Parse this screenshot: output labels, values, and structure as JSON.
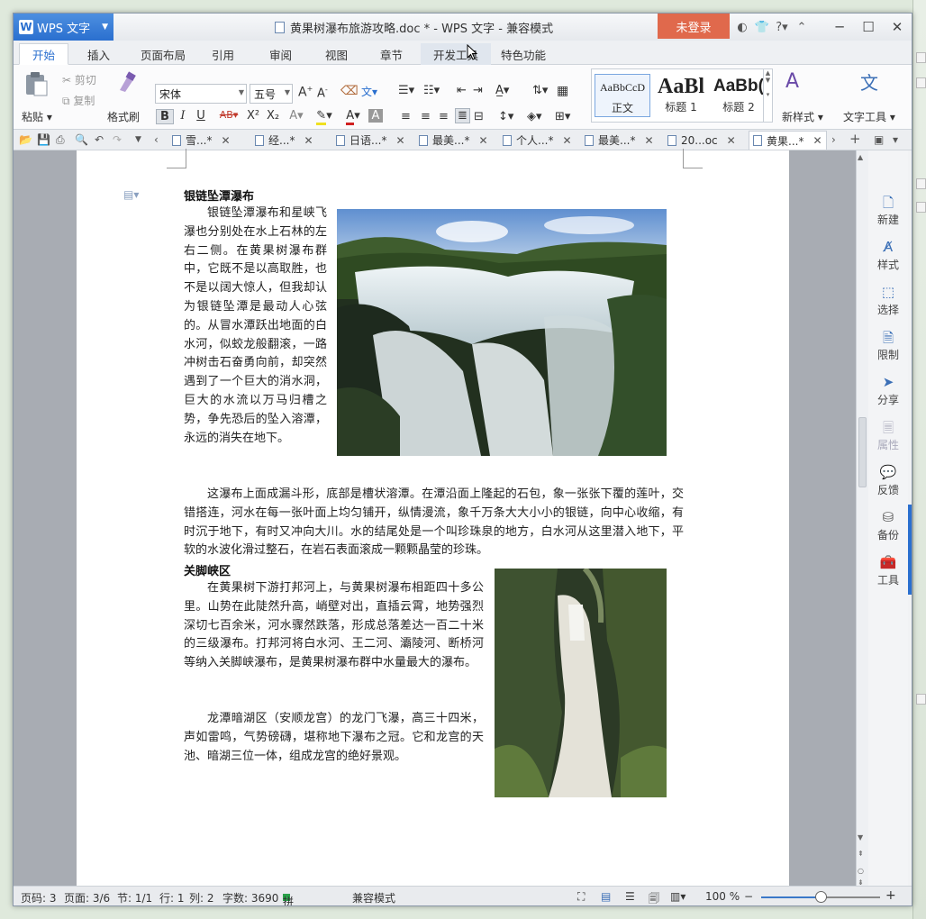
{
  "app": {
    "name": "WPS 文字",
    "title": "黄果树瀑布旅游攻略.doc * - WPS 文字 - 兼容模式",
    "login": "未登录"
  },
  "menu": {
    "tabs": [
      "开始",
      "插入",
      "页面布局",
      "引用",
      "审阅",
      "视图",
      "章节",
      "开发工具",
      "特色功能"
    ],
    "active": "开始"
  },
  "ribbon": {
    "paste": "粘贴",
    "cut": "剪切",
    "copy": "复制",
    "format_painter": "格式刷",
    "font_name": "宋体",
    "font_size": "五号",
    "styles": [
      {
        "preview": "AaBbCcD",
        "label": "正文"
      },
      {
        "preview": "AaBl",
        "label": "标题 1"
      },
      {
        "preview": "AaBb(",
        "label": "标题 2"
      }
    ],
    "new_style": "新样式",
    "text_tools": "文字工具"
  },
  "doc_tabs": [
    {
      "label": "雪...*",
      "active": false
    },
    {
      "label": "经...*",
      "active": false
    },
    {
      "label": "日语...*",
      "active": false
    },
    {
      "label": "最美...*",
      "active": false
    },
    {
      "label": "个人...*",
      "active": false
    },
    {
      "label": "最美...*",
      "active": false
    },
    {
      "label": "20...oc",
      "active": false
    },
    {
      "label": "黄果...*",
      "active": true
    }
  ],
  "document": {
    "section1_title": "银链坠潭瀑布",
    "section1_p1": "银链坠潭瀑布和星峡飞瀑也分别处在水上石林的左右二侧。在黄果树瀑布群中，它既不是以高取胜，也不是以阔大惊人，但我却认为银链坠潭是最动人心弦的。从冒水潭跃出地面的白水河，似蛟龙般翻滚，一路冲树击石奋勇向前，却突然遇到了一个巨大的消水洞，巨大的水流以万马归槽之势，争先恐后的坠入溶潭，永远的消失在地下。",
    "section1_p2": "这瀑布上面成漏斗形，底部是槽状溶潭。在潭沿面上隆起的石包，象一张张下覆的莲叶，交错搭连，河水在每一张叶面上均匀铺开，纵情漫流，象千万条大大小小的银链，向中心收缩，有时沉于地下，有时又冲向大川。水的结尾处是一个叫珍珠泉的地方，白水河从这里潜入地下，平软的水波化滑过整石，在岩石表面滚成一颗颗晶莹的珍珠。",
    "section2_title": "关脚峡区",
    "section2_p1": "在黄果树下游打邦河上，与黄果树瀑布相距四十多公里。山势在此陡然升高，峭壁对出，直插云霄，地势强烈深切七百余米，河水骤然跌落，形成总落差达一百二十米的三级瀑布。打邦河将白水河、王二河、灞陵河、断桥河等纳入关脚峡瀑布，是黄果树瀑布群中水量最大的瀑布。",
    "section2_p2": "龙潭暗湖区（安顺龙宫）的龙门飞瀑，高三十四米，声如雷鸣，气势磅礴，堪称地下瀑布之冠。它和龙宫的天池、暗湖三位一体，组成龙宫的绝好景观。"
  },
  "side_panel": [
    {
      "label": "新建",
      "icon": "new-doc-icon",
      "enabled": true
    },
    {
      "label": "样式",
      "icon": "style-icon",
      "enabled": true
    },
    {
      "label": "选择",
      "icon": "select-icon",
      "enabled": true
    },
    {
      "label": "限制",
      "icon": "restrict-icon",
      "enabled": true
    },
    {
      "label": "分享",
      "icon": "share-icon",
      "enabled": true
    },
    {
      "label": "属性",
      "icon": "properties-icon",
      "enabled": false
    },
    {
      "label": "反馈",
      "icon": "feedback-icon",
      "enabled": true
    },
    {
      "label": "备份",
      "icon": "backup-icon",
      "enabled": true
    },
    {
      "label": "工具",
      "icon": "toolbox-icon",
      "enabled": true
    }
  ],
  "status": {
    "page_code": "页码: 3",
    "pages": "页面: 3/6",
    "section": "节: 1/1",
    "row": "行: 1",
    "col": "列: 2",
    "word_count": "字数: 3690",
    "spell_check": "拼写检查",
    "mode": "兼容模式",
    "zoom": "100 %"
  },
  "colors": {
    "accent": "#2a6fcf",
    "login_button": "#e0694c"
  }
}
